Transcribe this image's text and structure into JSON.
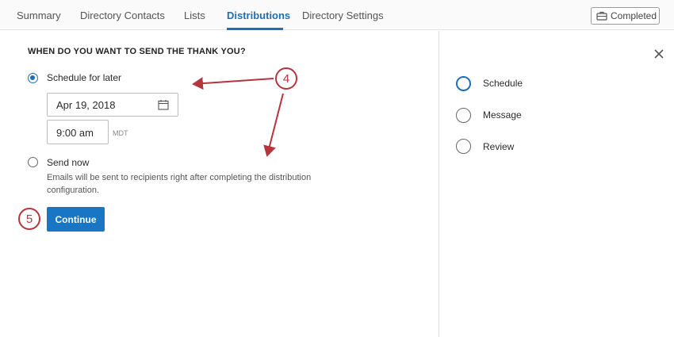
{
  "tabs": [
    {
      "label": "Summary"
    },
    {
      "label": "Directory Contacts"
    },
    {
      "label": "Lists"
    },
    {
      "label": "Distributions"
    },
    {
      "label": "Directory Settings"
    }
  ],
  "active_tab": "Distributions",
  "status_button": {
    "label": "Completed",
    "icon": "briefcase-icon"
  },
  "form": {
    "question": "WHEN DO YOU WANT TO SEND THE THANK YOU?",
    "schedule_option": {
      "label": "Schedule for later",
      "selected": true
    },
    "date": {
      "value": "Apr 19, 2018",
      "icon": "calendar-icon"
    },
    "time": {
      "value": "9:00 am",
      "timezone": "MDT"
    },
    "send_now_option": {
      "label": "Send now",
      "selected": false,
      "hint": "Emails will be sent to recipients right after completing the distribution configuration."
    },
    "continue_label": "Continue"
  },
  "annotations": [
    {
      "label": "4"
    },
    {
      "label": "5"
    }
  ],
  "steps": [
    {
      "label": "Schedule",
      "current": true
    },
    {
      "label": "Message",
      "current": false
    },
    {
      "label": "Review",
      "current": false
    }
  ],
  "close_icon": "close-icon",
  "colors": {
    "accent": "#1f6fb4",
    "button": "#1976c4",
    "annotation": "#b5353d"
  }
}
